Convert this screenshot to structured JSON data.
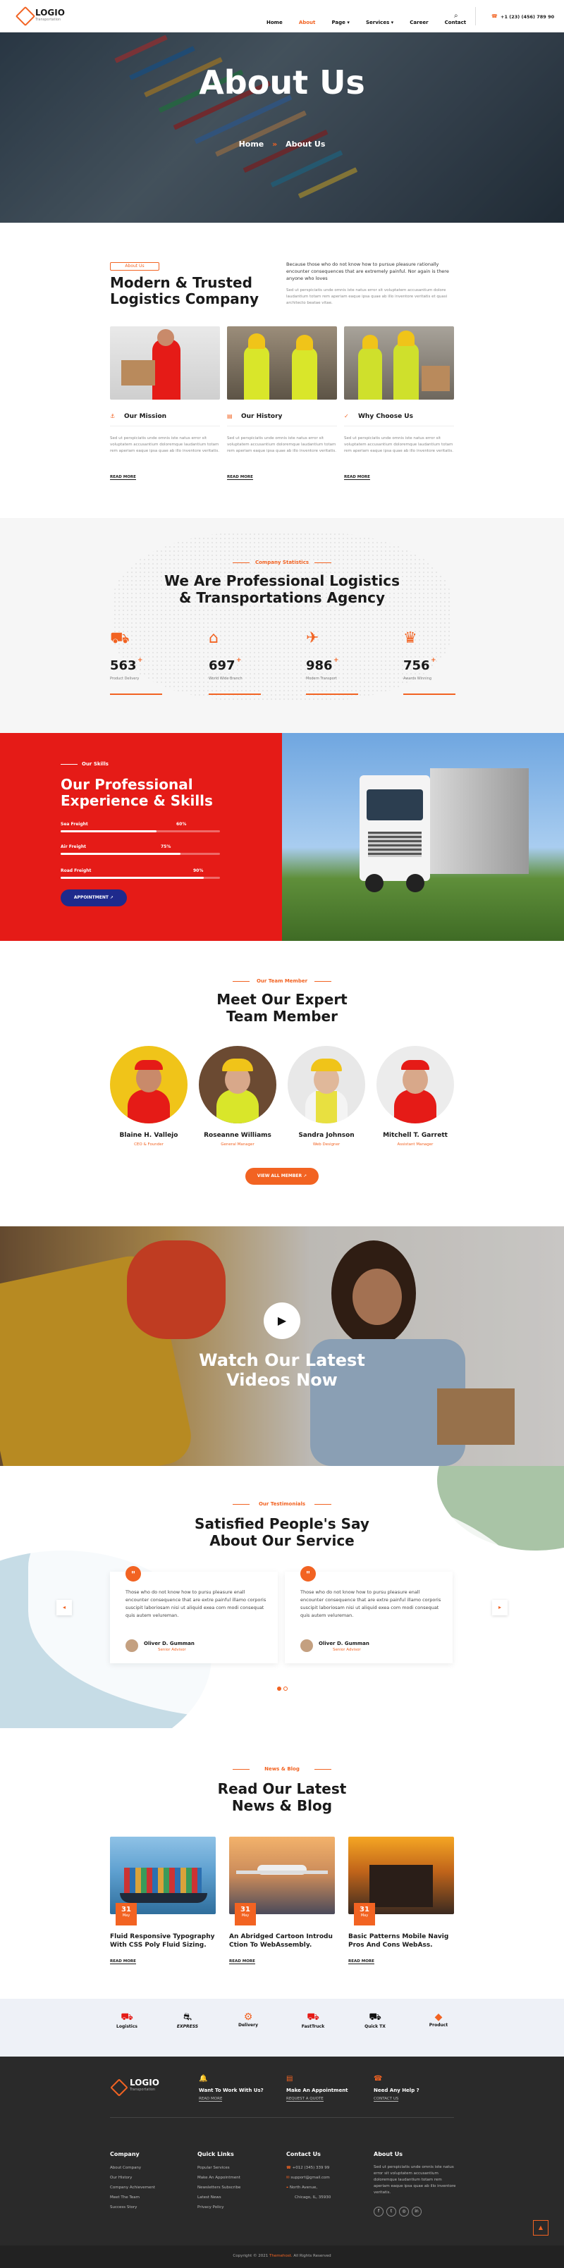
{
  "header": {
    "logo": "LOGIO",
    "logo_sub": "Transportation",
    "nav": [
      "Home",
      "About",
      "Page",
      "Services",
      "Career",
      "Contact"
    ],
    "phone": "+1 (23) (456) 789 90"
  },
  "hero": {
    "title": "About Us",
    "crumb_home": "Home",
    "crumb_sep": "»",
    "crumb_current": "About Us"
  },
  "about": {
    "tag": "About Us",
    "title_l1": "Modern & Trusted",
    "title_l2": "Logistics Company",
    "lead": "Because those who do not know how to pursue pleasure rationally encounter consequences that are extremely painful. Nor again is there anyone who loves",
    "body": "Sed ut perspiciatis unde omnis iste natus error sit voluptatem accusantium dolore laudantium totam rem aperiam eaque ipsa quae ab illo inventore veritatis et quasi architecto beatae vitae.",
    "cards": [
      {
        "title": "Our Mission",
        "text": "Sed ut perspiciatis unde omnis iste natus error sit voluptatem accusantium doloremque laudantium totam rem aperiam eaque ipsa quae ab illo inventore veritatis.",
        "more": "READ MORE"
      },
      {
        "title": "Our History",
        "text": "Sed ut perspiciatis unde omnis iste natus error sit voluptatem accusantium doloremque laudantium totam rem aperiam eaque ipsa quae ab illo inventore veritatis.",
        "more": "READ MORE"
      },
      {
        "title": "Why Choose Us",
        "text": "Sed ut perspiciatis unde omnis iste natus error sit voluptatem accusantium doloremque laudantium totam rem aperiam eaque ipsa quae ab illo inventore veritatis.",
        "more": "READ MORE"
      }
    ]
  },
  "stats": {
    "tag": "Company Statistics",
    "title_l1": "We Are Professional Logistics",
    "title_l2": "& Transportations Agency",
    "items": [
      {
        "num": "563",
        "label": "Product Delivery"
      },
      {
        "num": "697",
        "label": "World Wide Branch"
      },
      {
        "num": "986",
        "label": "Modern Transport"
      },
      {
        "num": "756",
        "label": "Awards Winning"
      }
    ],
    "plus": "+"
  },
  "skills": {
    "tag": "Our Skills",
    "title_l1": "Our Professional",
    "title_l2": "Experience & Skills",
    "items": [
      {
        "label": "Sea Freight",
        "pct": "60%",
        "value": 0.6
      },
      {
        "label": "Air Freight",
        "pct": "75%",
        "value": 0.75
      },
      {
        "label": "Road Freight",
        "pct": "90%",
        "value": 0.9
      }
    ],
    "button": "APPOINTMENT"
  },
  "team": {
    "tag": "Our Team Member",
    "title_l1": "Meet Our Expert",
    "title_l2": "Team Member",
    "members": [
      {
        "name": "Blaine H. Vallejo",
        "role": "CEO & Founder"
      },
      {
        "name": "Roseanne Williams",
        "role": "General Manager"
      },
      {
        "name": "Sandra Johnson",
        "role": "Web Designer"
      },
      {
        "name": "Mitchell T. Garrett",
        "role": "Assistant Manager"
      }
    ],
    "button": "VIEW ALL MEMBER"
  },
  "video": {
    "title_l1": "Watch Our Latest",
    "title_l2": "Videos Now"
  },
  "testimonials": {
    "tag": "Our Testimonials",
    "title_l1": "Satisfied People's Say",
    "title_l2": "About Our Service",
    "items": [
      {
        "text": "Those who do not know how to pursu pleasure enall encounter consequence that are extre painful illamo corporis suscipit laboriosam nisi ut aliquid exea com modi consequat quis autem velureman.",
        "name": "Oliver D. Gumman",
        "role": "Senior Advisor"
      },
      {
        "text": "Those who do not know how to pursu pleasure enall encounter consequence that are extre painful illamo corporis suscipit laboriosam nisi ut aliquid exea com modi consequat quis autem velureman.",
        "name": "Oliver D. Gumman",
        "role": "Senior Advisor"
      }
    ]
  },
  "blog": {
    "tag": "News & Blog",
    "title_l1": "Read Our Latest",
    "title_l2": "News & Blog",
    "posts": [
      {
        "day": "31",
        "month": "May",
        "title": "Fluid Responsive Typography With CSS Poly Fluid Sizing.",
        "more": "READ MORE"
      },
      {
        "day": "31",
        "month": "May",
        "title": "An Abridged Cartoon Introdu Ction To WebAssembly.",
        "more": "READ MORE"
      },
      {
        "day": "31",
        "month": "May",
        "title": "Basic Patterns Mobile Navig Pros And Cons WebAss.",
        "more": "READ MORE"
      }
    ]
  },
  "brands": [
    "Logistics",
    "EXPRESS",
    "Delivery",
    "FastTruck",
    "Quick TX",
    "Product"
  ],
  "footer": {
    "logo": "LOGIO",
    "logo_sub": "Transportation",
    "cta": [
      {
        "title": "Want To Work With Us?",
        "link": "READ MORE"
      },
      {
        "title": "Make An Appointment",
        "link": "REQUEST A QUOTE"
      },
      {
        "title": "Need Any Help ?",
        "link": "CONTACT US"
      }
    ],
    "company_h": "Company",
    "company": [
      "About Company",
      "Our History",
      "Company Achievement",
      "Meet The Team",
      "Success Story"
    ],
    "quick_h": "Quick Links",
    "quick": [
      "Popular Services",
      "Make An Appointment",
      "Newsletters Subscribe",
      "Latest News",
      "Privacy Policy"
    ],
    "contact_h": "Contact Us",
    "contact": [
      "+012 (345) 339 99",
      "support@gmail.com",
      "North Avenue,",
      "Chicago, IL, 35930"
    ],
    "about_h": "About Us",
    "about_text": "Sed ut perspiciatis unde omnis iste natus error sit voluptatem accusantium doloremque laudantium totam rem aperiam eaque ipsa quae ab illo inventore veritatis.",
    "copyright_pre": "Copyright © 2021",
    "copyright_brand": "Themehost.",
    "copyright_post": "All Rights Reserved"
  },
  "colors": {
    "accent": "#f26322",
    "red": "#e51b17",
    "dark": "#2a2a2a",
    "navy": "#1e2a8c"
  }
}
